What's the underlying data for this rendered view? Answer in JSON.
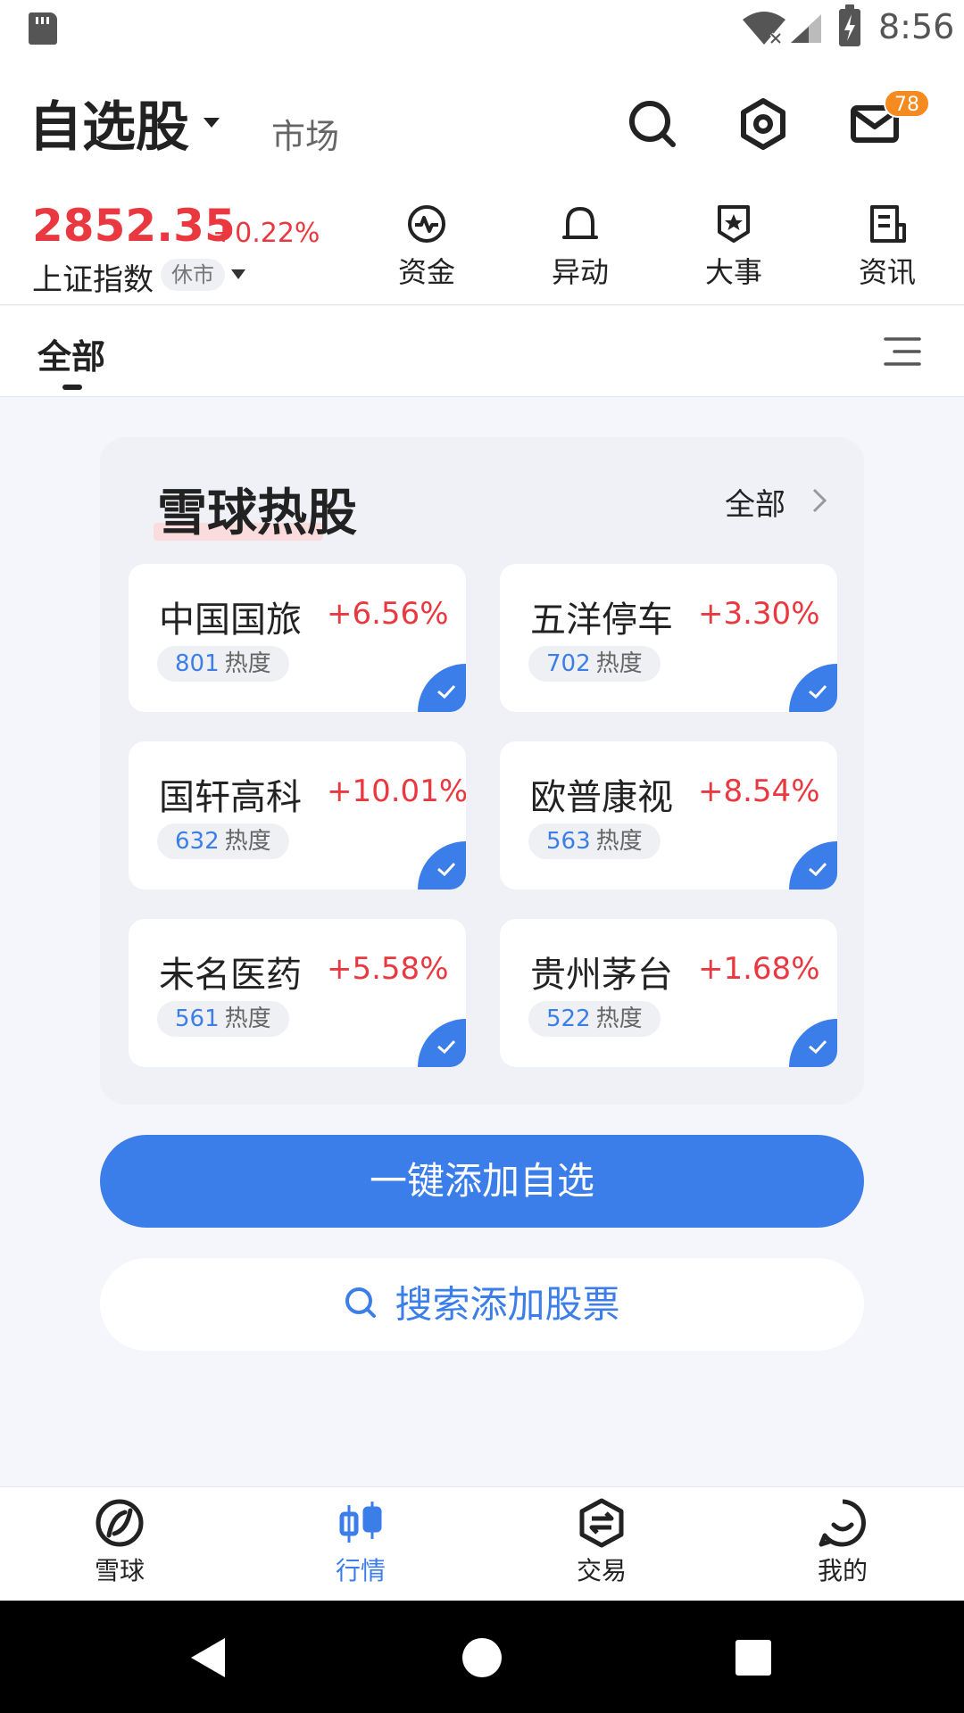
{
  "status_bar": {
    "time": "8:56"
  },
  "header": {
    "title": "自选股",
    "market_tab": "市场",
    "unread_badge": "78"
  },
  "index": {
    "value": "2852.35",
    "change": "+0.22%",
    "name": "上证指数",
    "status": "休市"
  },
  "quick_actions": [
    {
      "label": "资金",
      "icon": "pulse-icon"
    },
    {
      "label": "异动",
      "icon": "bell-icon"
    },
    {
      "label": "大事",
      "icon": "star-badge-icon"
    },
    {
      "label": "资讯",
      "icon": "document-icon"
    }
  ],
  "segment": {
    "all": "全部"
  },
  "hot_stocks": {
    "title": "雪球热股",
    "see_all": "全部",
    "items": [
      {
        "name": "中国国旅",
        "change": "+6.56%",
        "heat": "801",
        "heat_label": "热度"
      },
      {
        "name": "五洋停车",
        "change": "+3.30%",
        "heat": "702",
        "heat_label": "热度"
      },
      {
        "name": "国轩高科",
        "change": "+10.01%",
        "heat": "632",
        "heat_label": "热度"
      },
      {
        "name": "欧普康视",
        "change": "+8.54%",
        "heat": "563",
        "heat_label": "热度"
      },
      {
        "name": "未名医药",
        "change": "+5.58%",
        "heat": "561",
        "heat_label": "热度"
      },
      {
        "name": "贵州茅台",
        "change": "+1.68%",
        "heat": "522",
        "heat_label": "热度"
      }
    ]
  },
  "actions": {
    "add_all": "一键添加自选",
    "search_add": "搜索添加股票"
  },
  "bottom_nav": [
    {
      "label": "雪球",
      "active": false
    },
    {
      "label": "行情",
      "active": true
    },
    {
      "label": "交易",
      "active": false
    },
    {
      "label": "我的",
      "active": false
    }
  ],
  "colors": {
    "accent_blue": "#3b7ee9",
    "rise_red": "#e9383f",
    "badge_orange": "#f58a1f",
    "page_bg": "#f5f6fb"
  }
}
